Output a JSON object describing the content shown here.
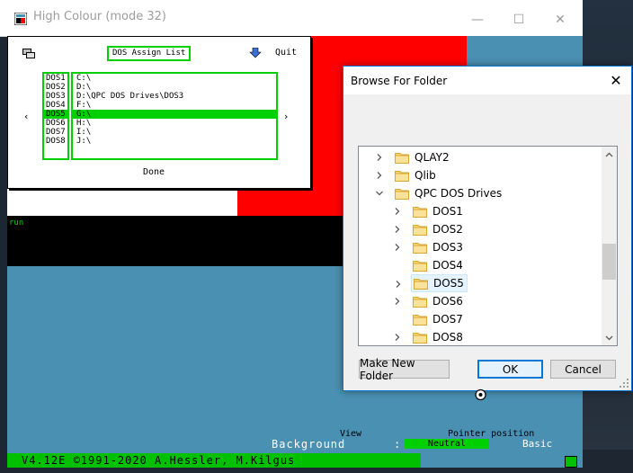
{
  "qpc_window": {
    "title": "High Colour (mode 32)",
    "controls": {
      "minimize": "—",
      "maximize": "☐",
      "close": "✕"
    }
  },
  "dos_dialog": {
    "title": "DOS Assign List",
    "quit": "Quit",
    "done": "Done",
    "left_arrow": "‹",
    "right_arrow": "›",
    "drives": [
      {
        "name": "DOS1",
        "path": "C:\\"
      },
      {
        "name": "DOS2",
        "path": "D:\\"
      },
      {
        "name": "DOS3",
        "path": "D:\\QPC DOS Drives\\DOS3"
      },
      {
        "name": "DOS4",
        "path": "F:\\"
      },
      {
        "name": "DOS5",
        "path": "G:\\"
      },
      {
        "name": "DOS6",
        "path": "H:\\"
      },
      {
        "name": "DOS7",
        "path": "I:\\"
      },
      {
        "name": "DOS8",
        "path": "J:\\"
      }
    ],
    "selected_index": 4
  },
  "qpc_screen": {
    "run": "run",
    "view_label": "View",
    "pointer_label": "Pointer position",
    "background_label": "Background",
    "colon": ":",
    "neutral": "Neutral",
    "basic": "Basic",
    "status": "V4.12E ©1991-2020 A.Hessler, M.Kilgus"
  },
  "browse_dialog": {
    "title": "Browse For Folder",
    "close": "✕",
    "tree": [
      {
        "label": "QLAY2",
        "level": 0,
        "chevron": "right"
      },
      {
        "label": "Qlib",
        "level": 0,
        "chevron": "right"
      },
      {
        "label": "QPC DOS Drives",
        "level": 0,
        "chevron": "down"
      },
      {
        "label": "DOS1",
        "level": 1,
        "chevron": "right"
      },
      {
        "label": "DOS2",
        "level": 1,
        "chevron": "right"
      },
      {
        "label": "DOS3",
        "level": 1,
        "chevron": "right"
      },
      {
        "label": "DOS4",
        "level": 1,
        "chevron": "none"
      },
      {
        "label": "DOS5",
        "level": 1,
        "chevron": "right"
      },
      {
        "label": "DOS6",
        "level": 1,
        "chevron": "right"
      },
      {
        "label": "DOS7",
        "level": 1,
        "chevron": "none"
      },
      {
        "label": "DOS8",
        "level": 1,
        "chevron": "right"
      }
    ],
    "selected_label": "DOS5",
    "buttons": {
      "new_folder": "Make New Folder",
      "ok": "OK",
      "cancel": "Cancel"
    }
  },
  "colors": {
    "qpc_green": "#00d000",
    "qpc_red": "#ff0000",
    "qpc_blue": "#4a90b2",
    "win_accent": "#0078d7"
  },
  "icons": {
    "app": "qpc-app-icon",
    "folder": "folder-icon",
    "chevron_right": "chevron-right-icon",
    "chevron_down": "chevron-down-icon"
  }
}
